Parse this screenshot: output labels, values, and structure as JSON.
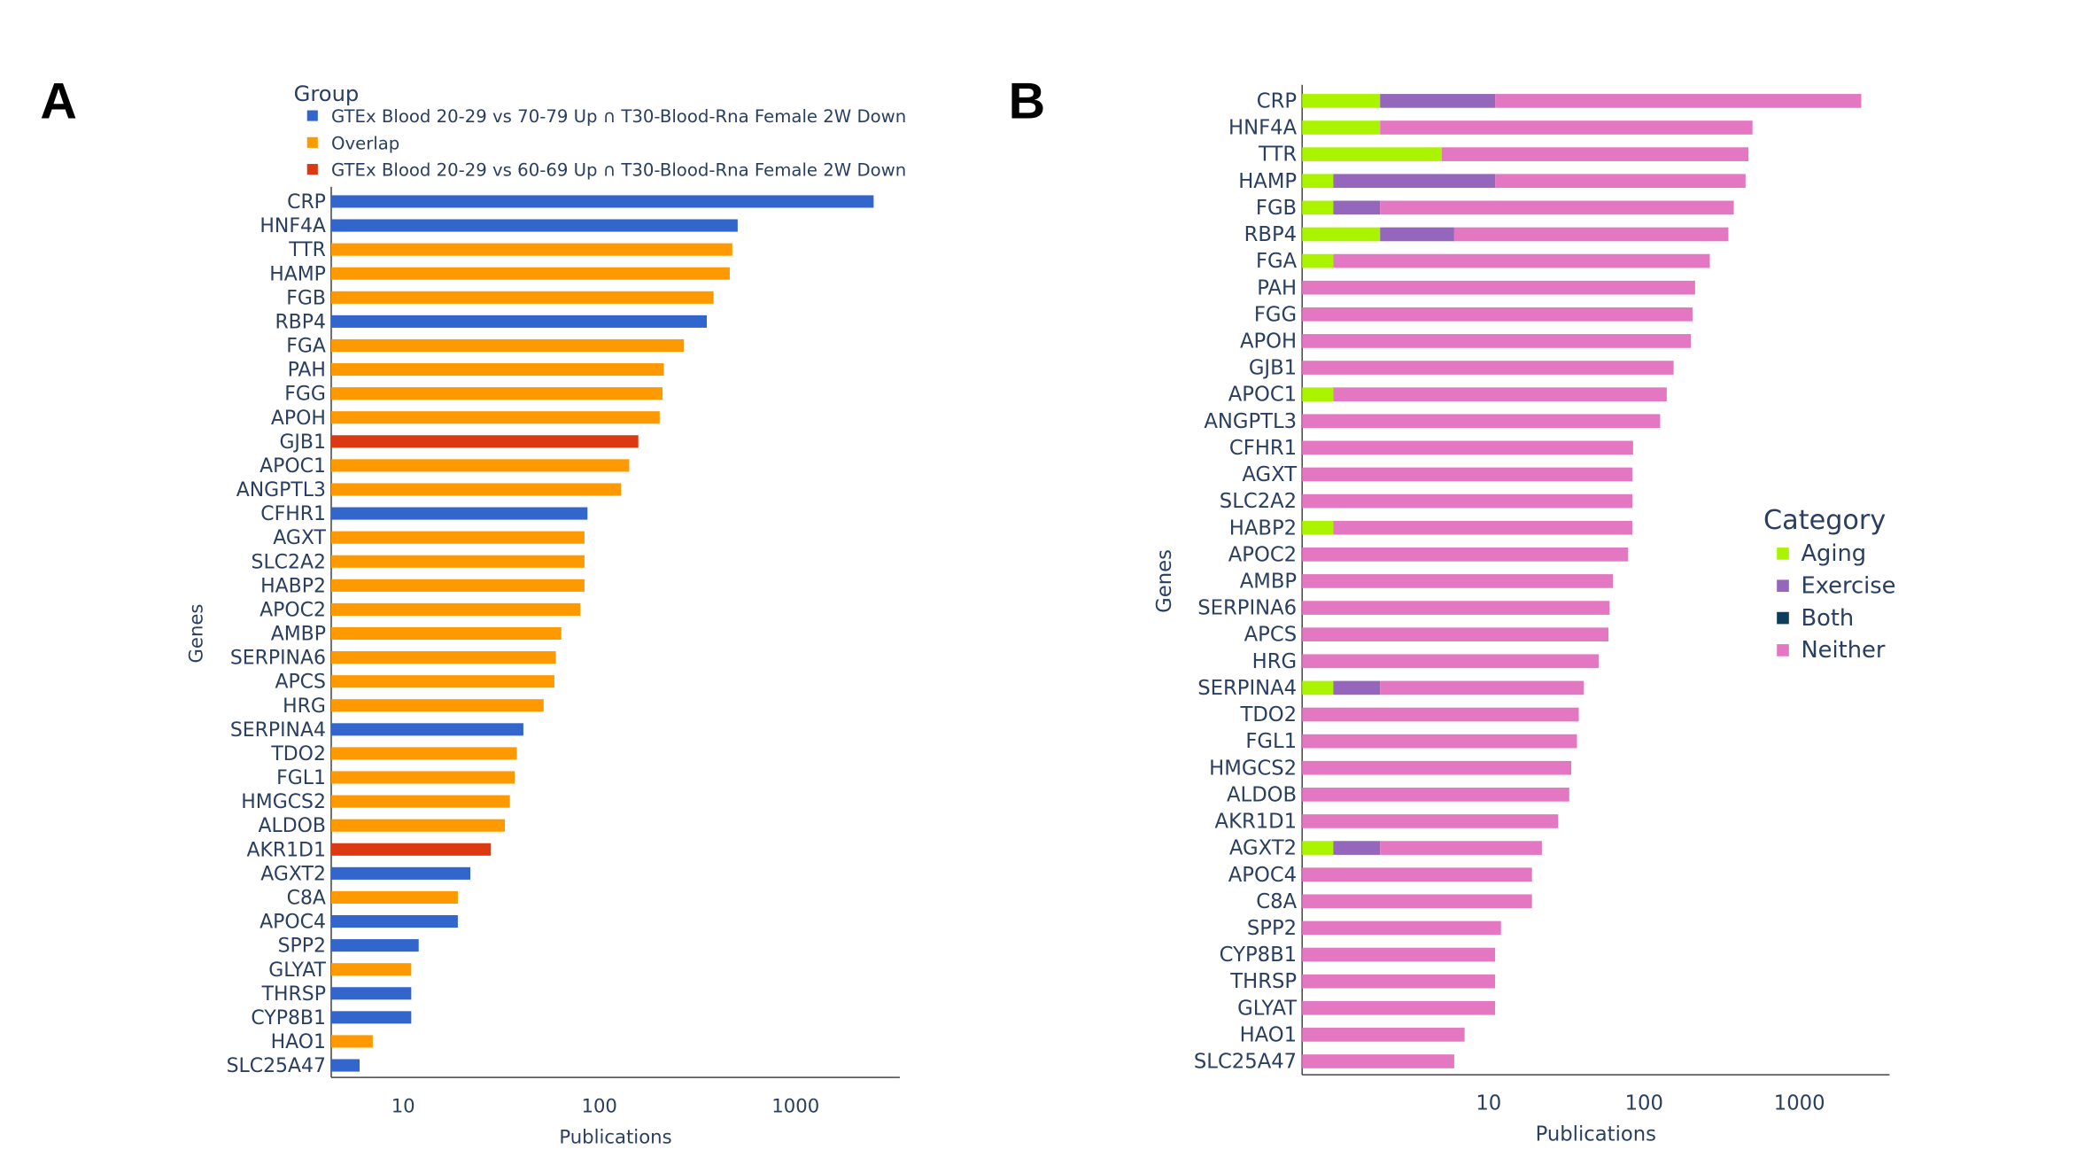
{
  "chart_data": [
    {
      "panel_label": "A",
      "type": "bar",
      "orientation": "horizontal",
      "x_scale": "log",
      "xlim": [
        4.3,
        3400
      ],
      "xticks": [
        "10",
        "100",
        "1000"
      ],
      "xtick_values": [
        10,
        100,
        1000
      ],
      "xlabel": "Publications",
      "ylabel": "Genes",
      "legend": {
        "title": "Group",
        "placement": "top-left",
        "entries": [
          {
            "key": "g7079",
            "label": "GTEx Blood 20-29 vs 70-79 Up ∩ T30-Blood-Rna Female 2W Down",
            "color": "#3366cc"
          },
          {
            "key": "overlap",
            "label": "Overlap",
            "color": "#ff9900"
          },
          {
            "key": "g6069",
            "label": "GTEx Blood 20-29 vs 60-69 Up ∩ T30-Blood-Rna Female 2W Down",
            "color": "#dc3912"
          }
        ]
      },
      "categories": [
        "CRP",
        "HNF4A",
        "TTR",
        "HAMP",
        "FGB",
        "RBP4",
        "FGA",
        "PAH",
        "FGG",
        "APOH",
        "GJB1",
        "APOC1",
        "ANGPTL3",
        "CFHR1",
        "AGXT",
        "SLC2A2",
        "HABP2",
        "APOC2",
        "AMBP",
        "SERPINA6",
        "APCS",
        "HRG",
        "SERPINA4",
        "TDO2",
        "FGL1",
        "HMGCS2",
        "ALDOB",
        "AKR1D1",
        "AGXT2",
        "C8A",
        "APOC4",
        "SPP2",
        "GLYAT",
        "THRSP",
        "CYP8B1",
        "HAO1",
        "SLC25A47"
      ],
      "values": [
        2500,
        507,
        476,
        462,
        382,
        353,
        270,
        213,
        210,
        203,
        158,
        142,
        129,
        87,
        84,
        84,
        84,
        80,
        64,
        60,
        59,
        52,
        41,
        38,
        37,
        35,
        33,
        28,
        22,
        19,
        19,
        12,
        11,
        11,
        11,
        7,
        6
      ],
      "groups": [
        "g7079",
        "g7079",
        "overlap",
        "overlap",
        "overlap",
        "g7079",
        "overlap",
        "overlap",
        "overlap",
        "overlap",
        "g6069",
        "overlap",
        "overlap",
        "g7079",
        "overlap",
        "overlap",
        "overlap",
        "overlap",
        "overlap",
        "overlap",
        "overlap",
        "overlap",
        "g7079",
        "overlap",
        "overlap",
        "overlap",
        "overlap",
        "g6069",
        "g7079",
        "overlap",
        "g7079",
        "g7079",
        "overlap",
        "g7079",
        "g7079",
        "overlap",
        "g7079"
      ]
    },
    {
      "panel_label": "B",
      "type": "bar",
      "orientation": "horizontal",
      "stacked": true,
      "x_scale": "log",
      "xlim": [
        0.63,
        3800
      ],
      "xticks": [
        "10",
        "100",
        "1000"
      ],
      "xtick_values": [
        10,
        100,
        1000
      ],
      "xlabel": "Publications",
      "ylabel": "Genes",
      "legend": {
        "title": "Category",
        "placement": "right",
        "entries": [
          {
            "key": "aging",
            "label": "Aging",
            "color": "#aaf400"
          },
          {
            "key": "exercise",
            "label": "Exercise",
            "color": "#9467bd"
          },
          {
            "key": "both",
            "label": "Both",
            "color": "#0b3d5c"
          },
          {
            "key": "neither",
            "label": "Neither",
            "color": "#e377c2"
          }
        ]
      },
      "categories": [
        "CRP",
        "HNF4A",
        "TTR",
        "HAMP",
        "FGB",
        "RBP4",
        "FGA",
        "PAH",
        "FGG",
        "APOH",
        "GJB1",
        "APOC1",
        "ANGPTL3",
        "CFHR1",
        "AGXT",
        "SLC2A2",
        "HABP2",
        "APOC2",
        "AMBP",
        "SERPINA6",
        "APCS",
        "HRG",
        "SERPINA4",
        "TDO2",
        "FGL1",
        "HMGCS2",
        "ALDOB",
        "AKR1D1",
        "AGXT2",
        "APOC4",
        "C8A",
        "SPP2",
        "CYP8B1",
        "THRSP",
        "GLYAT",
        "HAO1",
        "SLC25A47"
      ],
      "series": [
        {
          "name": "Aging",
          "values": [
            2,
            2,
            5,
            1,
            1,
            2,
            1,
            0,
            0,
            0,
            0,
            1,
            0,
            0,
            0,
            0,
            1,
            0,
            0,
            0,
            0,
            0,
            1,
            0,
            0,
            0,
            0,
            0,
            1,
            0,
            0,
            0,
            0,
            0,
            0,
            0,
            0
          ]
        },
        {
          "name": "Exercise",
          "values": [
            9,
            0,
            0,
            10,
            1,
            4,
            0,
            0,
            0,
            0,
            0,
            0,
            0,
            0,
            0,
            0,
            0,
            0,
            0,
            0,
            0,
            0,
            1,
            0,
            0,
            0,
            0,
            0,
            1,
            0,
            0,
            0,
            0,
            0,
            0,
            0,
            0
          ]
        },
        {
          "name": "Both",
          "values": [
            0,
            0,
            0,
            0,
            0,
            0,
            0,
            0,
            0,
            0,
            0,
            0,
            0,
            0,
            0,
            0,
            0,
            0,
            0,
            0,
            0,
            0,
            0,
            0,
            0,
            0,
            0,
            0,
            0,
            0,
            0,
            0,
            0,
            0,
            0,
            0,
            0
          ]
        },
        {
          "name": "Neither",
          "values": [
            2489,
            497,
            465,
            439,
            376,
            343,
            264,
            213,
            205,
            200,
            155,
            139,
            127,
            85,
            84,
            84,
            83,
            79,
            63,
            60,
            59,
            51,
            39,
            38,
            37,
            34,
            33,
            28,
            20,
            19,
            19,
            12,
            11,
            11,
            11,
            7,
            6
          ]
        }
      ]
    }
  ]
}
